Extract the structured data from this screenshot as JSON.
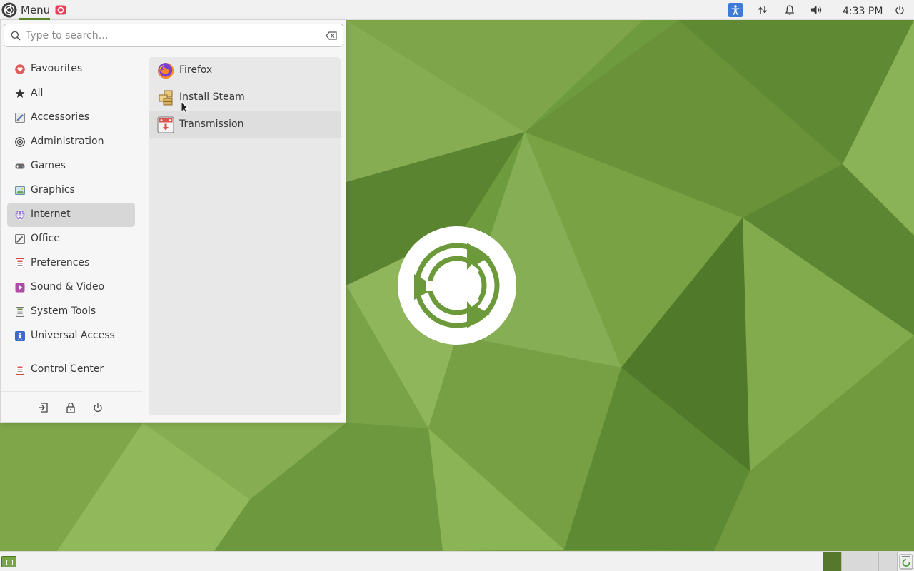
{
  "top_panel": {
    "menu_label": "Menu",
    "clock": "4:33 PM"
  },
  "search": {
    "placeholder": "Type to search…",
    "value": ""
  },
  "categories": [
    {
      "label": "Favourites",
      "icon": "heart-icon",
      "color": "#e05b5b"
    },
    {
      "label": "All",
      "icon": "star-icon",
      "color": "#333333"
    },
    {
      "label": "Accessories",
      "icon": "accessories-icon",
      "color": "#4a6fb5"
    },
    {
      "label": "Administration",
      "icon": "administration-icon",
      "color": "#555555"
    },
    {
      "label": "Games",
      "icon": "games-icon",
      "color": "#555555"
    },
    {
      "label": "Graphics",
      "icon": "graphics-icon",
      "color": "#5aa0d8"
    },
    {
      "label": "Internet",
      "icon": "internet-icon",
      "color": "#7d5bc9",
      "selected": true
    },
    {
      "label": "Office",
      "icon": "office-icon",
      "color": "#666666"
    },
    {
      "label": "Preferences",
      "icon": "preferences-icon",
      "color": "#d9534f"
    },
    {
      "label": "Sound & Video",
      "icon": "sound-video-icon",
      "color": "#b04aa8"
    },
    {
      "label": "System Tools",
      "icon": "system-tools-icon",
      "color": "#6a8a3a"
    },
    {
      "label": "Universal Access",
      "icon": "universal-access-icon",
      "color": "#3e68c9"
    }
  ],
  "control_center": {
    "label": "Control Center",
    "icon": "control-center-icon"
  },
  "apps": [
    {
      "label": "Firefox",
      "icon": "firefox-icon"
    },
    {
      "label": "Install Steam",
      "icon": "steam-installer-icon"
    },
    {
      "label": "Transmission",
      "icon": "transmission-icon",
      "hovered": true
    }
  ],
  "colors": {
    "accent": "#5f8a2d",
    "wallpaper": "#6e9a3e",
    "accessibility_tray": "#3e7bd6",
    "selected_category": "#d7d7d7"
  }
}
